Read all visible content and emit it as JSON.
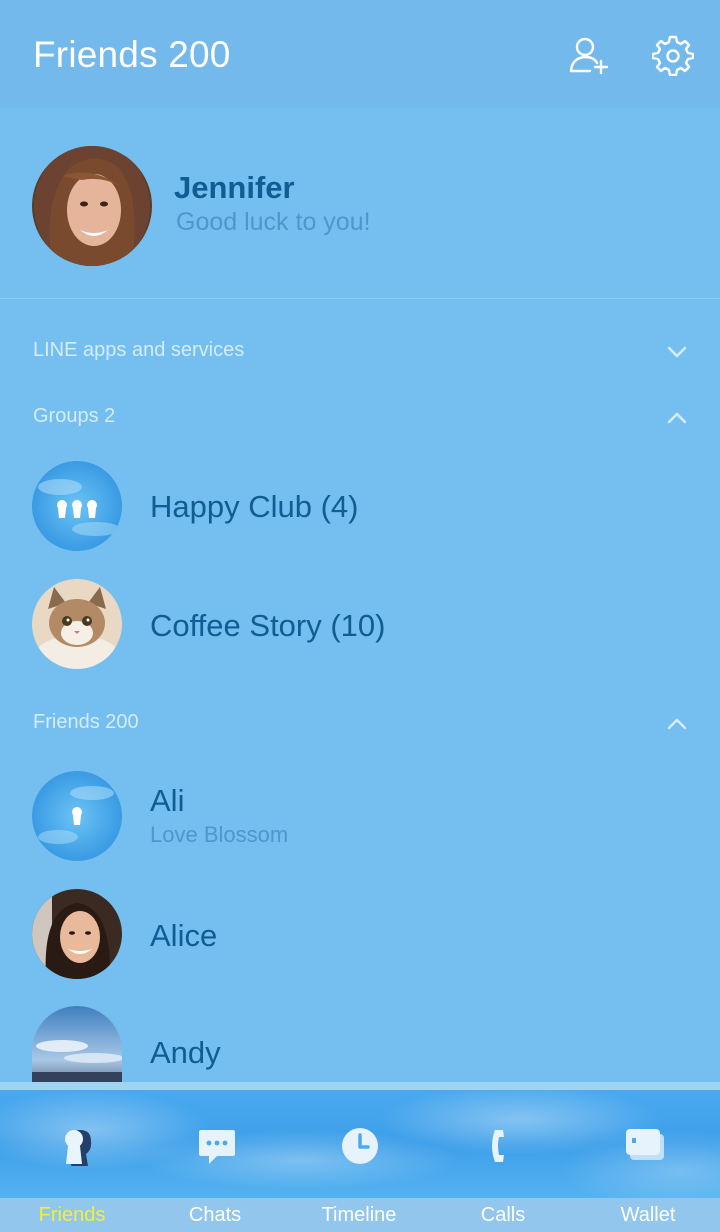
{
  "header": {
    "title": "Friends 200"
  },
  "profile": {
    "name": "Jennifer",
    "status": "Good luck to you!"
  },
  "sections": {
    "services": "LINE apps and services",
    "groups": "Groups 2",
    "friends": "Friends 200"
  },
  "groups": [
    {
      "name": "Happy Club (4)",
      "icon": "group-icon"
    },
    {
      "name": "Coffee Story (10)",
      "icon": "cat-photo"
    }
  ],
  "friends": [
    {
      "name": "Ali",
      "status": "Love Blossom",
      "icon": "keyhole-icon"
    },
    {
      "name": "Alice",
      "status": "",
      "icon": "person-photo"
    },
    {
      "name": "Andy",
      "status": "",
      "icon": "sky-photo"
    }
  ],
  "tabs": [
    {
      "label": "Friends",
      "icon": "person-keyhole-icon",
      "active": true
    },
    {
      "label": "Chats",
      "icon": "chat-bubble-icon",
      "active": false
    },
    {
      "label": "Timeline",
      "icon": "clock-icon",
      "active": false
    },
    {
      "label": "Calls",
      "icon": "phone-icon",
      "active": false
    },
    {
      "label": "Wallet",
      "icon": "wallet-icon",
      "active": false
    }
  ],
  "colors": {
    "background": "#74bfef",
    "header": "#73b9ec",
    "name_text": "#0f5d92",
    "status_text": "#4d97cc",
    "active_tab": "#f3ef3a"
  }
}
